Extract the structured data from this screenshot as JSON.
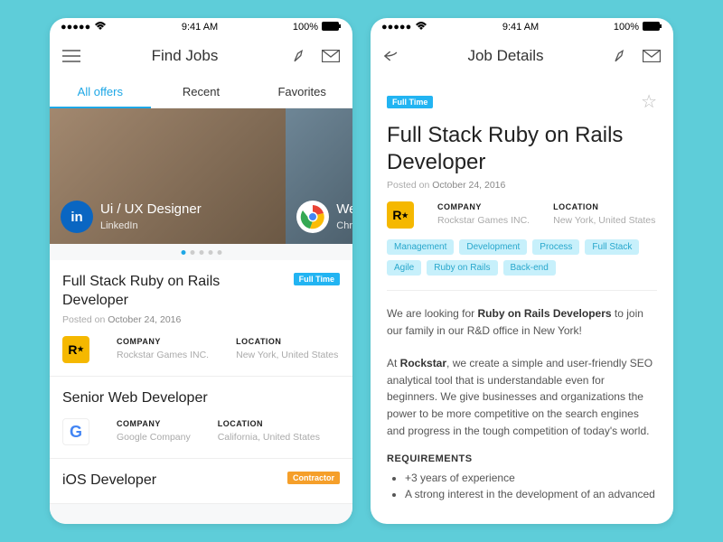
{
  "status": {
    "time": "9:41 AM",
    "battery": "100%"
  },
  "left": {
    "title": "Find Jobs",
    "tabs": [
      "All offers",
      "Recent",
      "Favorites"
    ],
    "carousel": {
      "slide1": {
        "title": "Ui / UX Designer",
        "sub": "LinkedIn"
      },
      "slide2": {
        "title": "We",
        "sub": "Chro"
      }
    },
    "cards": [
      {
        "title": "Full Stack Ruby on Rails Developer",
        "badge": "Full Time",
        "posted_label": "Posted on",
        "posted_date": "October 24, 2016",
        "company_label": "COMPANY",
        "company": "Rockstar Games INC.",
        "location_label": "LOCATION",
        "location": "New York, United States"
      },
      {
        "title": "Senior Web Developer",
        "company_label": "COMPANY",
        "company": "Google Company",
        "location_label": "LOCATION",
        "location": "California, United States"
      },
      {
        "title": "iOS Developer",
        "badge": "Contractor"
      }
    ]
  },
  "right": {
    "title": "Job Details",
    "badge": "Full Time",
    "job_title": "Full Stack Ruby on Rails Developer",
    "posted_label": "Posted on",
    "posted_date": "October 24, 2016",
    "company_label": "COMPANY",
    "company": "Rockstar Games INC.",
    "location_label": "LOCATION",
    "location": "New York, United States",
    "tags": [
      "Management",
      "Development",
      "Process",
      "Full Stack",
      "Agile",
      "Ruby on Rails",
      "Back-end"
    ],
    "desc1_a": "We are looking for ",
    "desc1_b": "Ruby on Rails Developers",
    "desc1_c": " to join our family in our R&D office in New York!",
    "desc2_a": "At ",
    "desc2_b": "Rockstar",
    "desc2_c": ", we create a simple and user-friendly SEO analytical tool that is understandable even for beginners. We give businesses and organizations the power to be more competitive on the search engines and progress in the tough competition of today's world.",
    "req_heading": "REQUIREMENTS",
    "reqs": [
      "+3 years of experience",
      "A strong interest in the development of an advanced"
    ]
  }
}
